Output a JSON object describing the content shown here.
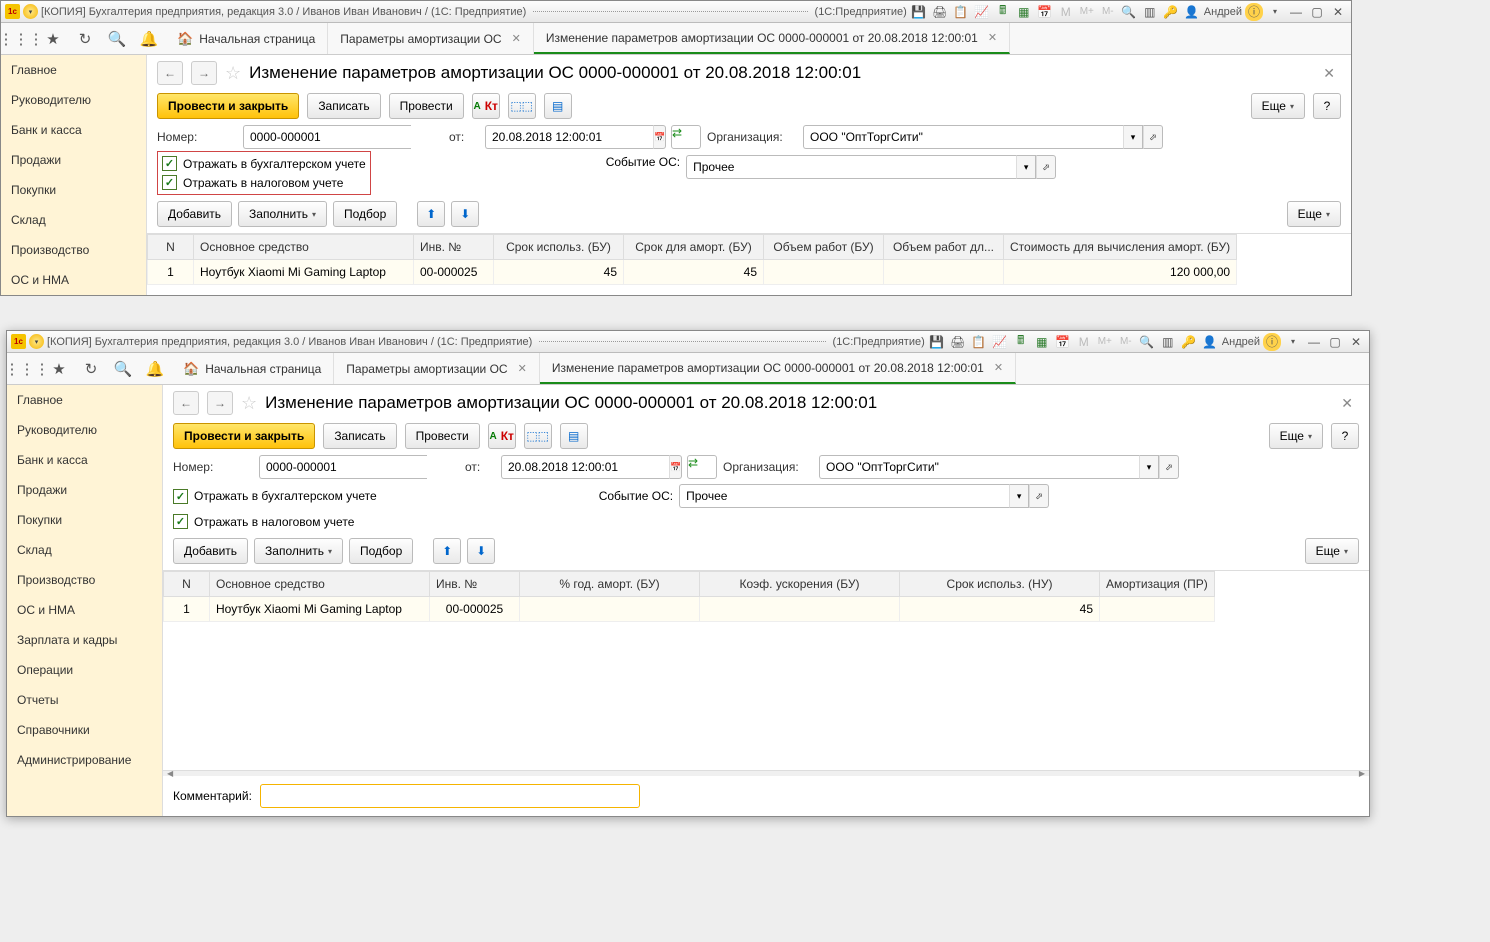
{
  "titlebar": {
    "title": "[КОПИЯ] Бухгалтерия предприятия, редакция 3.0 / Иванов Иван Иванович / (1С: Предприятие)",
    "mode": "(1С:Предприятие)",
    "user": "Андрей"
  },
  "toolbar_icons": {
    "m": "M",
    "mplus": "M+",
    "mminus": "M-"
  },
  "tabs": {
    "home": "Начальная страница",
    "t1": "Параметры амортизации ОС",
    "t2": "Изменение параметров амортизации ОС 0000-000001 от 20.08.2018 12:00:01"
  },
  "sidebar1": [
    "Главное",
    "Руководителю",
    "Банк и касса",
    "Продажи",
    "Покупки",
    "Склад",
    "Производство",
    "ОС и НМА"
  ],
  "sidebar2": [
    "Главное",
    "Руководителю",
    "Банк и касса",
    "Продажи",
    "Покупки",
    "Склад",
    "Производство",
    "ОС и НМА",
    "Зарплата и кадры",
    "Операции",
    "Отчеты",
    "Справочники",
    "Администрирование"
  ],
  "page": {
    "title": "Изменение параметров амортизации ОС 0000-000001 от 20.08.2018 12:00:01",
    "post_close": "Провести и закрыть",
    "record": "Записать",
    "post": "Провести",
    "more": "Еще",
    "help": "?"
  },
  "form": {
    "number_lbl": "Номер:",
    "number": "0000-000001",
    "from_lbl": "от:",
    "date": "20.08.2018 12:00:01",
    "org_lbl": "Организация:",
    "org": "ООО \"ОптТоргСити\"",
    "event_lbl": "Событие ОС:",
    "event": "Прочее"
  },
  "checks": {
    "bu": "Отражать в бухгалтерском учете",
    "nu": "Отражать в налоговом учете"
  },
  "tablebtns": {
    "add": "Добавить",
    "fill": "Заполнить",
    "select": "Подбор",
    "more": "Еще"
  },
  "table1": {
    "headers": [
      "N",
      "Основное средство",
      "Инв. №",
      "Срок использ. (БУ)",
      "Срок для аморт. (БУ)",
      "Объем работ (БУ)",
      "Объем работ дл...",
      "Стоимость для вычисления аморт. (БУ)"
    ],
    "row": {
      "n": "1",
      "asset": "Ноутбук Xiaomi Mi Gaming Laptop",
      "inv": "00-000025",
      "term_bu": "45",
      "term_amort": "45",
      "vol1": "",
      "vol2": "",
      "cost": "120 000,00"
    }
  },
  "table2": {
    "headers": [
      "N",
      "Основное средство",
      "Инв. №",
      "% год. аморт. (БУ)",
      "Коэф. ускорения (БУ)",
      "Срок использ. (НУ)",
      "Амортизация (ПР)"
    ],
    "row": {
      "n": "1",
      "asset": "Ноутбук Xiaomi Mi Gaming Laptop",
      "inv": "00-000025",
      "pct": "",
      "koef": "",
      "term_nu": "45",
      "amort": ""
    }
  },
  "comment": {
    "lbl": "Комментарий:",
    "val": ""
  }
}
